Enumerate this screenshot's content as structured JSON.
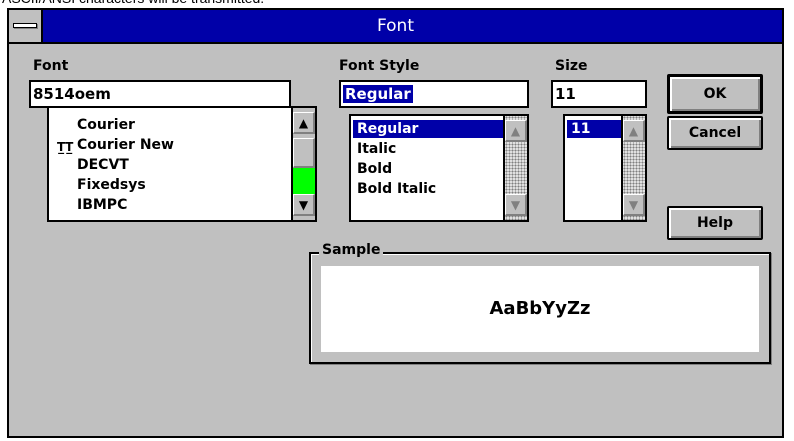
{
  "top_caption": "ASCII/ANSI characters will be transmitted.",
  "window": {
    "title": "Font"
  },
  "font": {
    "label": "Font",
    "value": "8514oem",
    "items": [
      "Courier",
      "Courier New",
      "DECVT",
      "Fixedsys",
      "IBMPC"
    ],
    "truetype_icon": "TrueType-icon"
  },
  "style": {
    "label": "Font Style",
    "value": "Regular",
    "items": [
      "Regular",
      "Italic",
      "Bold",
      "Bold Italic"
    ],
    "selected": "Regular"
  },
  "size": {
    "label": "Size",
    "value": "11",
    "items": [
      "11"
    ],
    "selected": "11"
  },
  "buttons": {
    "ok": "OK",
    "cancel": "Cancel",
    "help": "Help"
  },
  "sample": {
    "label": "Sample",
    "text": "AaBbYyZz"
  },
  "colors": {
    "title_bar": "#0000a8",
    "face": "#c0c0c0",
    "thumb_green": "#00ff00"
  }
}
